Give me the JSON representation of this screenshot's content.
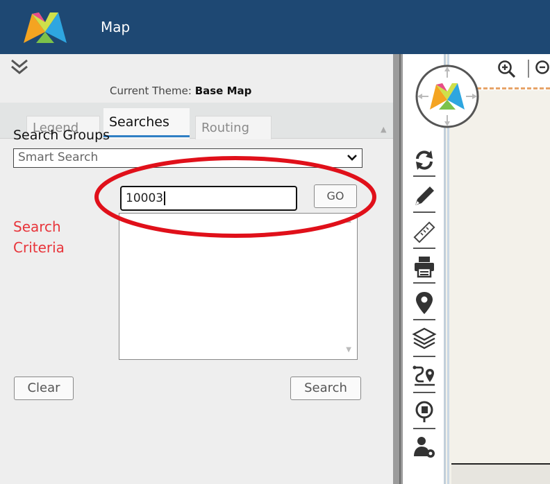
{
  "header": {
    "title": "Map",
    "background_color": "#1e4873"
  },
  "panel": {
    "theme_label": "Current Theme:",
    "theme_value": "Base Map",
    "tabs": [
      {
        "label": "Legend",
        "active": false
      },
      {
        "label": "Searches",
        "active": true
      },
      {
        "label": "Routing",
        "active": false
      }
    ],
    "search_groups_label": "Search Groups",
    "search_groups_selected": "Smart Search",
    "search_criteria_label": "Search\nCriteria",
    "search_input_value": "10003",
    "go_label": "GO",
    "clear_label": "Clear",
    "search_label": "Search",
    "criteria_label_color": "#e8343a",
    "highlight_color": "#e0101a"
  },
  "map": {
    "tools": [
      "refresh-icon",
      "pencil-icon",
      "ruler-icon",
      "print-icon",
      "map-pin-icon",
      "layers-icon",
      "route-icon",
      "geo-locate-icon",
      "user-settings-icon"
    ]
  }
}
